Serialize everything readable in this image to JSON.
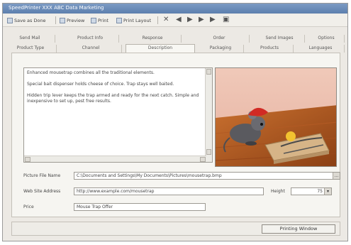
{
  "window": {
    "title": "SpeedPrinter XXX ABC Data Marketing"
  },
  "toolbar": {
    "items": [
      {
        "label": "Save as Done",
        "icon": "save-icon"
      },
      {
        "label": "Preview",
        "icon": "preview-icon"
      },
      {
        "label": "Print",
        "icon": "print-icon"
      },
      {
        "label": "Print Layout",
        "icon": "layout-icon"
      }
    ],
    "glyphs": [
      "✕",
      "◀",
      "▶",
      "▶",
      "▶",
      "▣"
    ]
  },
  "tabs": {
    "row1": [
      "Send Mail",
      "Product Info",
      "Response",
      "Order",
      "Send Images",
      "Options"
    ],
    "row2": [
      "Product Type",
      "Channel",
      "Description",
      "Packaging",
      "Products",
      "Languages"
    ],
    "active": "Description"
  },
  "description": {
    "paragraphs": [
      "Enhanced mousetrap combines all the traditional elements.",
      "Special bait dispenser holds cheese of choice. Trap stays well baited.",
      "Hidden trip lever keeps the trap armed and ready for the next catch. Simple and inexpensive to set up, pest free results."
    ]
  },
  "form": {
    "picture_file": {
      "label": "Picture File Name",
      "value": "C:\\Documents and Settings\\My Documents\\Pictures\\mousetrap.bmp"
    },
    "web_address": {
      "label": "Web Site Address",
      "value": "http://www.example.com/mousetrap"
    },
    "height": {
      "label": "Height",
      "value": "75"
    },
    "price": {
      "label": "Price",
      "value": "Mouse Trap Offer"
    }
  },
  "buttons": {
    "preview_window": "Printing Window"
  }
}
